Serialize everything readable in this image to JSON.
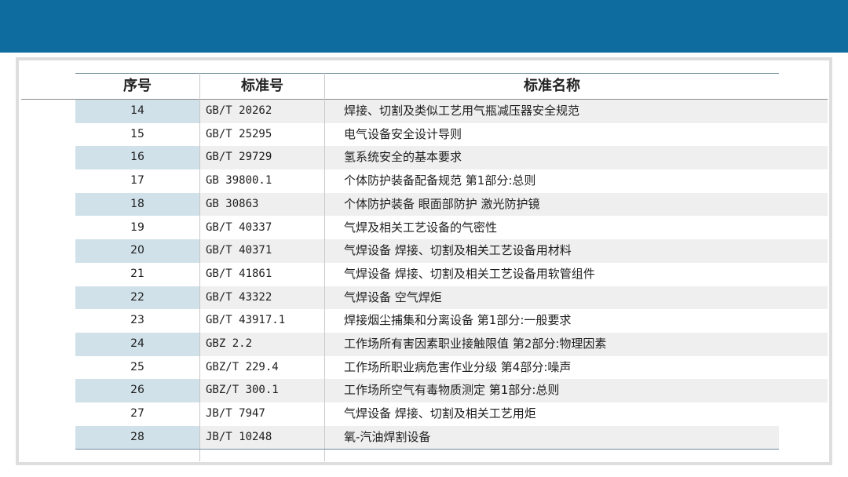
{
  "table": {
    "headers": {
      "no": "序号",
      "std": "标准号",
      "name": "标准名称"
    },
    "rows": [
      {
        "no": "14",
        "std": "GB/T 20262",
        "name": "焊接、切割及类似工艺用气瓶减压器安全规范"
      },
      {
        "no": "15",
        "std": "GB/T 25295",
        "name": "电气设备安全设计导则"
      },
      {
        "no": "16",
        "std": "GB/T 29729",
        "name": "氢系统安全的基本要求"
      },
      {
        "no": "17",
        "std": "GB 39800.1",
        "name": "个体防护装备配备规范 第1部分:总则"
      },
      {
        "no": "18",
        "std": "GB 30863",
        "name": "个体防护装备 眼面部防护 激光防护镜"
      },
      {
        "no": "19",
        "std": "GB/T 40337",
        "name": "气焊及相关工艺设备的气密性"
      },
      {
        "no": "20",
        "std": "GB/T 40371",
        "name": "气焊设备 焊接、切割及相关工艺设备用材料"
      },
      {
        "no": "21",
        "std": "GB/T 41861",
        "name": "气焊设备 焊接、切割及相关工艺设备用软管组件"
      },
      {
        "no": "22",
        "std": "GB/T 43322",
        "name": "气焊设备 空气焊炬"
      },
      {
        "no": "23",
        "std": "GB/T 43917.1",
        "name": "焊接烟尘捕集和分离设备 第1部分:一般要求"
      },
      {
        "no": "24",
        "std": "GBZ 2.2",
        "name": "工作场所有害因素职业接触限值 第2部分:物理因素"
      },
      {
        "no": "25",
        "std": "GBZ/T 229.4",
        "name": "工作场所职业病危害作业分级 第4部分:噪声"
      },
      {
        "no": "26",
        "std": "GBZ/T 300.1",
        "name": "工作场所空气有毒物质测定 第1部分:总则"
      },
      {
        "no": "27",
        "std": "JB/T 7947",
        "name": "气焊设备 焊接、切割及相关工艺用炬"
      },
      {
        "no": "28",
        "std": "JB/T 10248",
        "name": "氧-汽油焊割设备"
      }
    ]
  }
}
